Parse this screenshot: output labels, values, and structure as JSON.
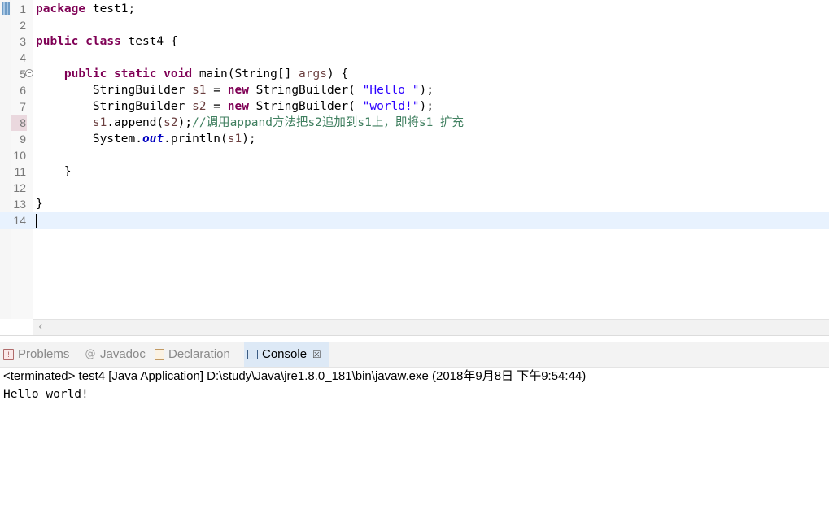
{
  "editor": {
    "lines": [
      {
        "n": "1",
        "tokens": [
          {
            "t": "package",
            "c": "kw"
          },
          {
            "t": " test1;",
            "c": ""
          }
        ]
      },
      {
        "n": "2",
        "tokens": []
      },
      {
        "n": "3",
        "tokens": [
          {
            "t": "public",
            "c": "kw"
          },
          {
            "t": " ",
            "c": ""
          },
          {
            "t": "class",
            "c": "kw"
          },
          {
            "t": " test4 {",
            "c": ""
          }
        ]
      },
      {
        "n": "4",
        "tokens": []
      },
      {
        "n": "5",
        "tokens": [
          {
            "t": "    ",
            "c": ""
          },
          {
            "t": "public",
            "c": "kw"
          },
          {
            "t": " ",
            "c": ""
          },
          {
            "t": "static",
            "c": "kw"
          },
          {
            "t": " ",
            "c": ""
          },
          {
            "t": "void",
            "c": "kw"
          },
          {
            "t": " main(String[] ",
            "c": ""
          },
          {
            "t": "args",
            "c": "var"
          },
          {
            "t": ") {",
            "c": ""
          }
        ]
      },
      {
        "n": "6",
        "tokens": [
          {
            "t": "        StringBuilder ",
            "c": ""
          },
          {
            "t": "s1",
            "c": "var"
          },
          {
            "t": " = ",
            "c": ""
          },
          {
            "t": "new",
            "c": "kw"
          },
          {
            "t": " StringBuilder( ",
            "c": ""
          },
          {
            "t": "\"Hello \"",
            "c": "str"
          },
          {
            "t": ");",
            "c": ""
          }
        ]
      },
      {
        "n": "7",
        "tokens": [
          {
            "t": "        StringBuilder ",
            "c": ""
          },
          {
            "t": "s2",
            "c": "var"
          },
          {
            "t": " = ",
            "c": ""
          },
          {
            "t": "new",
            "c": "kw"
          },
          {
            "t": " StringBuilder( ",
            "c": ""
          },
          {
            "t": "\"world!\"",
            "c": "str"
          },
          {
            "t": ");",
            "c": ""
          }
        ]
      },
      {
        "n": "8",
        "tokens": [
          {
            "t": "        ",
            "c": ""
          },
          {
            "t": "s1",
            "c": "var"
          },
          {
            "t": ".append(",
            "c": ""
          },
          {
            "t": "s2",
            "c": "var"
          },
          {
            "t": ");",
            "c": ""
          },
          {
            "t": "//调用",
            "c": "cmt"
          },
          {
            "t": "appand",
            "c": "cmt squiggle"
          },
          {
            "t": "方法把s2追加到s1上，即将s1 扩充",
            "c": "cmt"
          }
        ]
      },
      {
        "n": "9",
        "tokens": [
          {
            "t": "        System.",
            "c": ""
          },
          {
            "t": "out",
            "c": "field"
          },
          {
            "t": ".println(",
            "c": ""
          },
          {
            "t": "s1",
            "c": "var"
          },
          {
            "t": ");",
            "c": ""
          }
        ]
      },
      {
        "n": "10",
        "tokens": []
      },
      {
        "n": "11",
        "tokens": [
          {
            "t": "    }",
            "c": ""
          }
        ]
      },
      {
        "n": "12",
        "tokens": []
      },
      {
        "n": "13",
        "tokens": [
          {
            "t": "}",
            "c": ""
          }
        ]
      },
      {
        "n": "14",
        "tokens": []
      }
    ],
    "hscroll_arrow": "‹"
  },
  "tabs": {
    "problems": "Problems",
    "javadoc": "Javadoc",
    "declaration": "Declaration",
    "console": "Console",
    "close_glyph": "☒"
  },
  "console": {
    "header": "<terminated> test4 [Java Application] D:\\study\\Java\\jre1.8.0_181\\bin\\javaw.exe (2018年9月8日 下午9:54:44)",
    "output": "Hello world!"
  }
}
